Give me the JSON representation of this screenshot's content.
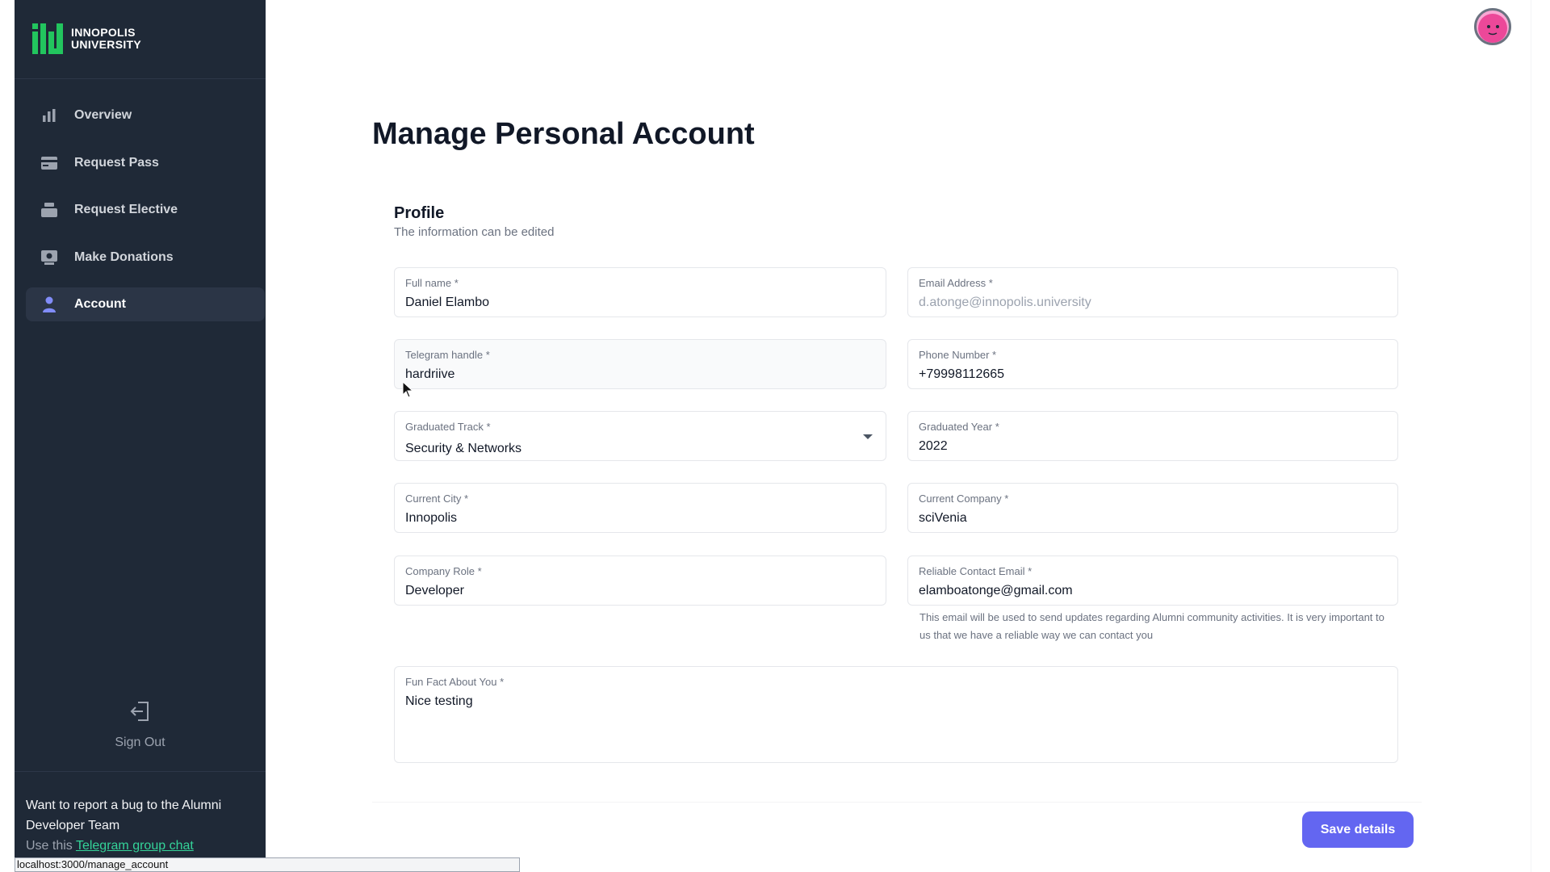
{
  "brand": {
    "line1": "INNOPOLIS",
    "line2": "UNIVERSITY",
    "accent": "#22c55e"
  },
  "sidebar": {
    "items": [
      {
        "label": "Overview",
        "icon": "bar-chart-icon",
        "active": false
      },
      {
        "label": "Request Pass",
        "icon": "card-icon",
        "active": false
      },
      {
        "label": "Request Elective",
        "icon": "stack-icon",
        "active": false
      },
      {
        "label": "Make Donations",
        "icon": "donation-icon",
        "active": false
      },
      {
        "label": "Account",
        "icon": "user-icon",
        "active": true
      }
    ],
    "signout": "Sign Out",
    "bug_title": "Want to report a bug to the Alumni Developer Team",
    "bug_prefix": "Use this",
    "bug_link": "Telegram group chat"
  },
  "status_url": "localhost:3000/manage_account",
  "page": {
    "title": "Manage Personal Account",
    "profile_title": "Profile",
    "profile_subtitle": "The information can be edited"
  },
  "form": {
    "full_name": {
      "label": "Full name *",
      "value": "Daniel Elambo"
    },
    "email": {
      "label": "Email Address *",
      "value": "d.atonge@innopolis.university"
    },
    "telegram": {
      "label": "Telegram handle *",
      "value": "hardriive"
    },
    "phone": {
      "label": "Phone Number *",
      "value": "+79998112665"
    },
    "track": {
      "label": "Graduated Track *",
      "value": "Security & Networks"
    },
    "year": {
      "label": "Graduated Year *",
      "value": "2022"
    },
    "city": {
      "label": "Current City *",
      "value": "Innopolis"
    },
    "company": {
      "label": "Current Company *",
      "value": "sciVenia"
    },
    "role": {
      "label": "Company Role *",
      "value": "Developer"
    },
    "contact_email": {
      "label": "Reliable Contact Email *",
      "value": "elamboatonge@gmail.com"
    },
    "contact_helper": "This email will be used to send updates regarding Alumni community activities. It is very important to us that we have a reliable way we can contact you",
    "fun_fact": {
      "label": "Fun Fact About You *",
      "value": "Nice testing"
    }
  },
  "actions": {
    "save": "Save details",
    "save_color": "#6366f1"
  }
}
